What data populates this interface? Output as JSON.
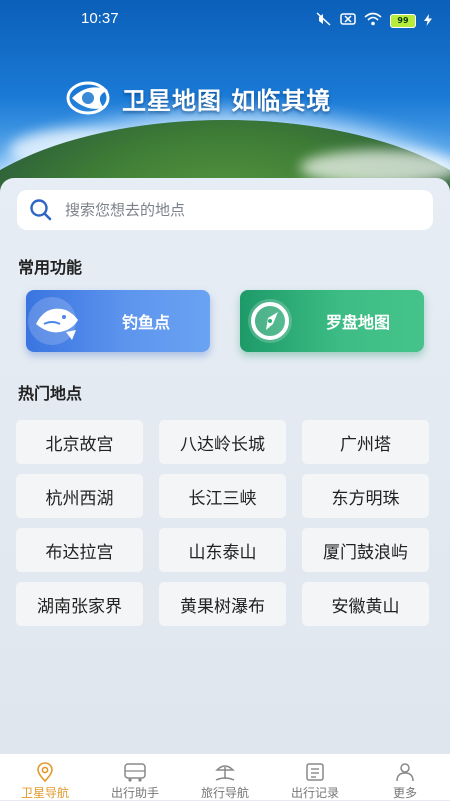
{
  "status": {
    "time": "10:37",
    "battery": "99"
  },
  "hero": {
    "title": "卫星地图 如临其境"
  },
  "search": {
    "placeholder": "搜索您想去的地点"
  },
  "common": {
    "title": "常用功能",
    "items": [
      {
        "label": "钓鱼点",
        "icon": "fish-icon",
        "color": "#4a85e8"
      },
      {
        "label": "罗盘地图",
        "icon": "compass-icon",
        "color": "#2eae77"
      }
    ]
  },
  "hot": {
    "title": "热门地点",
    "items": [
      "北京故宫",
      "八达岭长城",
      "广州塔",
      "杭州西湖",
      "长江三峡",
      "东方明珠",
      "布达拉宫",
      "山东泰山",
      "厦门鼓浪屿",
      "湖南张家界",
      "黄果树瀑布",
      "安徽黄山"
    ]
  },
  "tabs": [
    {
      "label": "卫星导航",
      "icon": "map-pin-icon",
      "active": true
    },
    {
      "label": "出行助手",
      "icon": "bus-icon",
      "active": false
    },
    {
      "label": "旅行导航",
      "icon": "beach-icon",
      "active": false
    },
    {
      "label": "出行记录",
      "icon": "record-icon",
      "active": false
    },
    {
      "label": "更多",
      "icon": "user-icon",
      "active": false
    }
  ],
  "colors": {
    "accent": "#e39a2b",
    "fish_button": "#4a85e8",
    "compass_button": "#2eae77"
  }
}
